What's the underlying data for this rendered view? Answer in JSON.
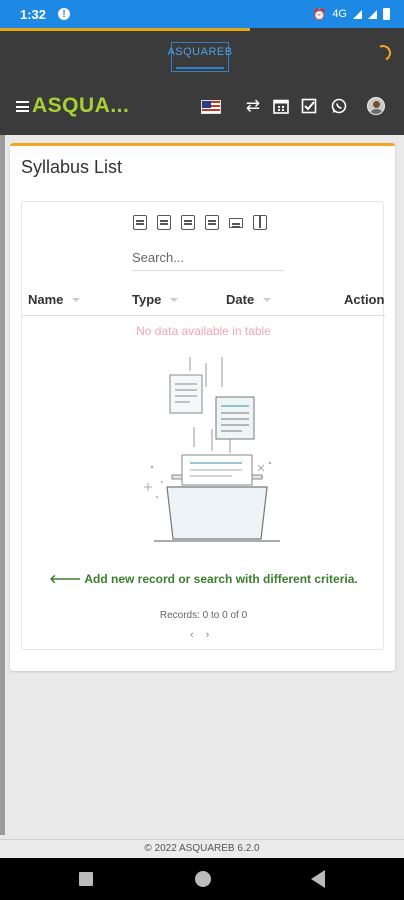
{
  "status_bar": {
    "time": "1:32",
    "network": "4G"
  },
  "app_bar": {
    "logo_text": "ASQUAREB",
    "brand": "ASQUA...",
    "loading_progress_percent": 62,
    "icons": [
      "menu-icon",
      "us-flag-icon",
      "swap-icon",
      "calendar-icon",
      "checkbox-icon",
      "whatsapp-icon",
      "avatar"
    ]
  },
  "card": {
    "title": "Syllabus List",
    "search_placeholder": "Search...",
    "toolbar_icons": [
      "copy-icon",
      "excel-icon",
      "csv-icon",
      "pdf-icon",
      "print-icon",
      "columns-icon"
    ],
    "columns": [
      "Name",
      "Type",
      "Date",
      "Action"
    ],
    "empty_text": "No data available in table",
    "hint": "Add new record or search with different criteria.",
    "records": "Records: 0 to 0 of 0",
    "pager_prev": "‹",
    "pager_next": "›"
  },
  "footer": {
    "text": "© 2022 ASQUAREB 6.2.0"
  },
  "colors": {
    "status_bar": "#1e88e5",
    "app_bar": "#3b3b3b",
    "brand": "#a6d133",
    "accent": "#f5a623",
    "hint": "#3c7d2f",
    "empty": "#f2a7b2"
  }
}
